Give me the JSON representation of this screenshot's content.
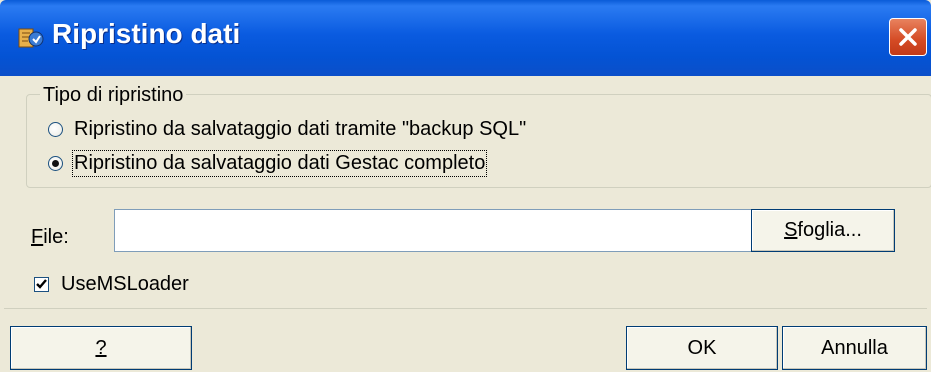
{
  "window": {
    "title": "Ripristino dati",
    "app_icon": "restore-app-icon",
    "close_icon": "close-icon",
    "accent": "#0A5BE0",
    "close_color": "#D44A24"
  },
  "group": {
    "legend": "Tipo di ripristino",
    "options": [
      {
        "label": "Ripristino da salvataggio dati tramite \"backup SQL\"",
        "selected": false
      },
      {
        "label": "Ripristino da salvataggio dati Gestac completo",
        "selected": true
      }
    ]
  },
  "file": {
    "label": "File:",
    "value": "",
    "browse_button": "Sfoglia..."
  },
  "options": {
    "use_ms_loader_label": "UseMSLoader",
    "use_ms_loader_checked": true
  },
  "footer": {
    "help_button": "?",
    "ok_button": "OK",
    "cancel_button": "Annulla"
  }
}
